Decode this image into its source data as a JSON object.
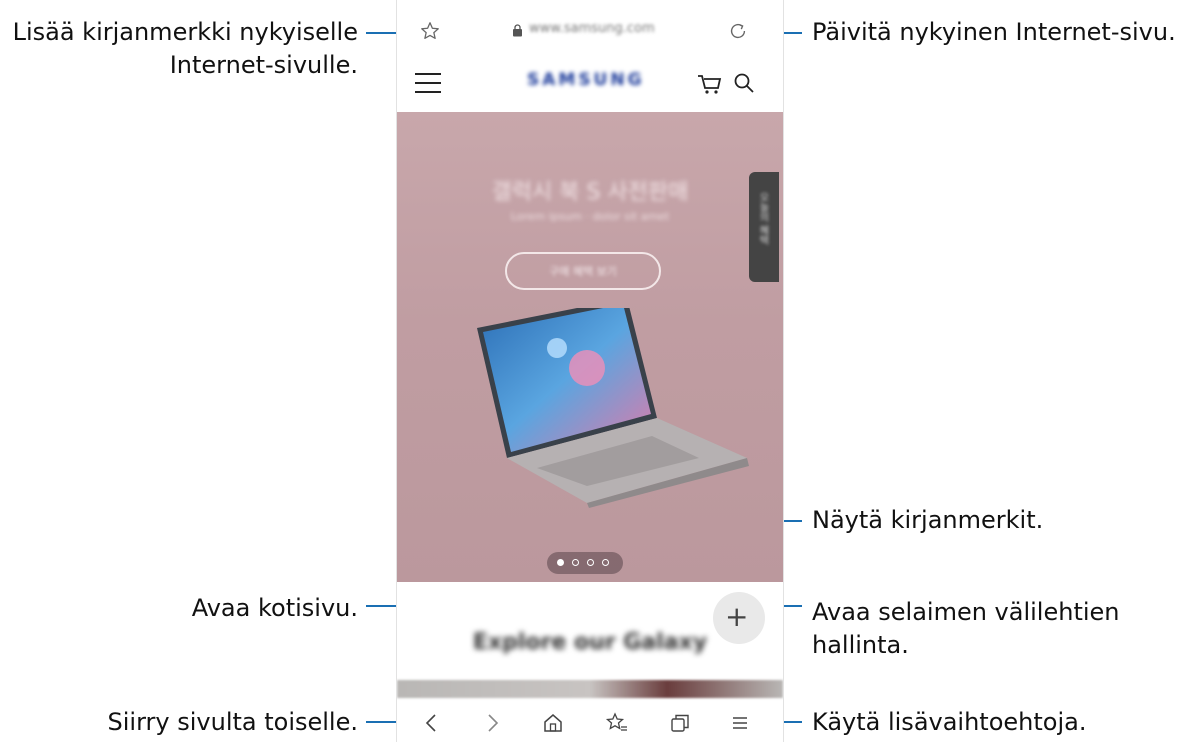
{
  "callouts": {
    "bookmark_add_line1": "Lisää kirjanmerkki nykyiselle",
    "bookmark_add_line2": "Internet-sivulle.",
    "refresh": "Päivitä nykyinen Internet-sivu.",
    "show_bookmarks": "Näytä kirjanmerkit.",
    "home": "Avaa kotisivu.",
    "tabs_line1": "Avaa selaimen välilehtien",
    "tabs_line2": "hallinta.",
    "navigate": "Siirry sivulta toiselle.",
    "more_options": "Käytä lisävaihtoehtoja."
  },
  "browser": {
    "url": "www.samsung.com",
    "brand": "SAMSUNG",
    "hero_title": "갤럭시 북 S 사전판매",
    "hero_subtitle": "Lorem ipsum · dolor sit amet",
    "hero_button": "구매 혜택 보기",
    "side_tab": "오늘의 혜택",
    "explore_heading": "Explore our Galaxy",
    "fab_label": "+"
  },
  "colors": {
    "callout_line": "#1a6fb3",
    "hero_bg": "#c3a2a6"
  },
  "icons": [
    "star-icon",
    "lock-icon",
    "reload-icon",
    "hamburger-icon",
    "cart-icon",
    "search-icon",
    "back-icon",
    "forward-icon",
    "home-icon",
    "bookmarks-icon",
    "tabs-icon",
    "menu-icon"
  ]
}
